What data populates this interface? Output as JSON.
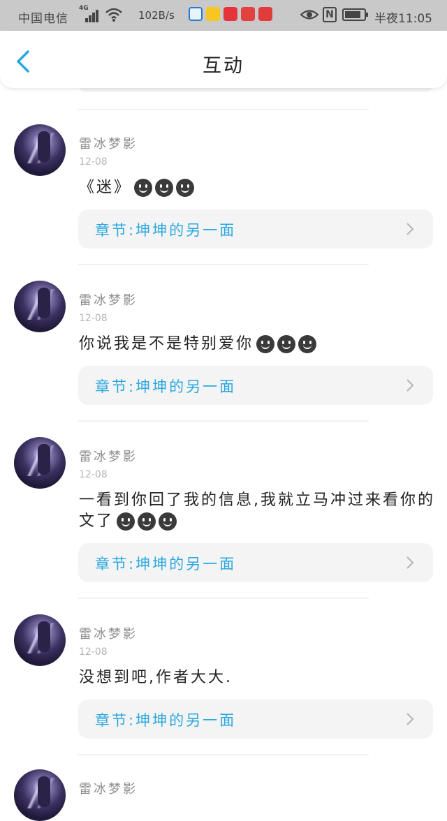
{
  "status_bar": {
    "carrier": "中国电信",
    "network": "4G",
    "speed": "102B/s",
    "time": "半夜11:05",
    "nfc": "N"
  },
  "header": {
    "title": "互动",
    "back_icon": "chevron-left-icon"
  },
  "colors": {
    "accent": "#2aa7df",
    "card_bg": "#f4f4f4",
    "status_bg": "#c9c9c9"
  },
  "comments": [
    {
      "user": "雷冰梦影",
      "date": "12-08",
      "text": "《迷》",
      "emoji_count": 3,
      "chapter": "章节:坤坤的另一面"
    },
    {
      "user": "雷冰梦影",
      "date": "12-08",
      "text": "你说我是不是特别爱你",
      "emoji_count": 3,
      "chapter": "章节:坤坤的另一面"
    },
    {
      "user": "雷冰梦影",
      "date": "12-08",
      "text": "一看到你回了我的信息,我就立马冲过来看你的文了",
      "emoji_count": 3,
      "chapter": "章节:坤坤的另一面"
    },
    {
      "user": "雷冰梦影",
      "date": "12-08",
      "text": "没想到吧,作者大大.",
      "emoji_count": 0,
      "chapter": "章节:坤坤的另一面"
    },
    {
      "user": "雷冰梦影"
    }
  ]
}
